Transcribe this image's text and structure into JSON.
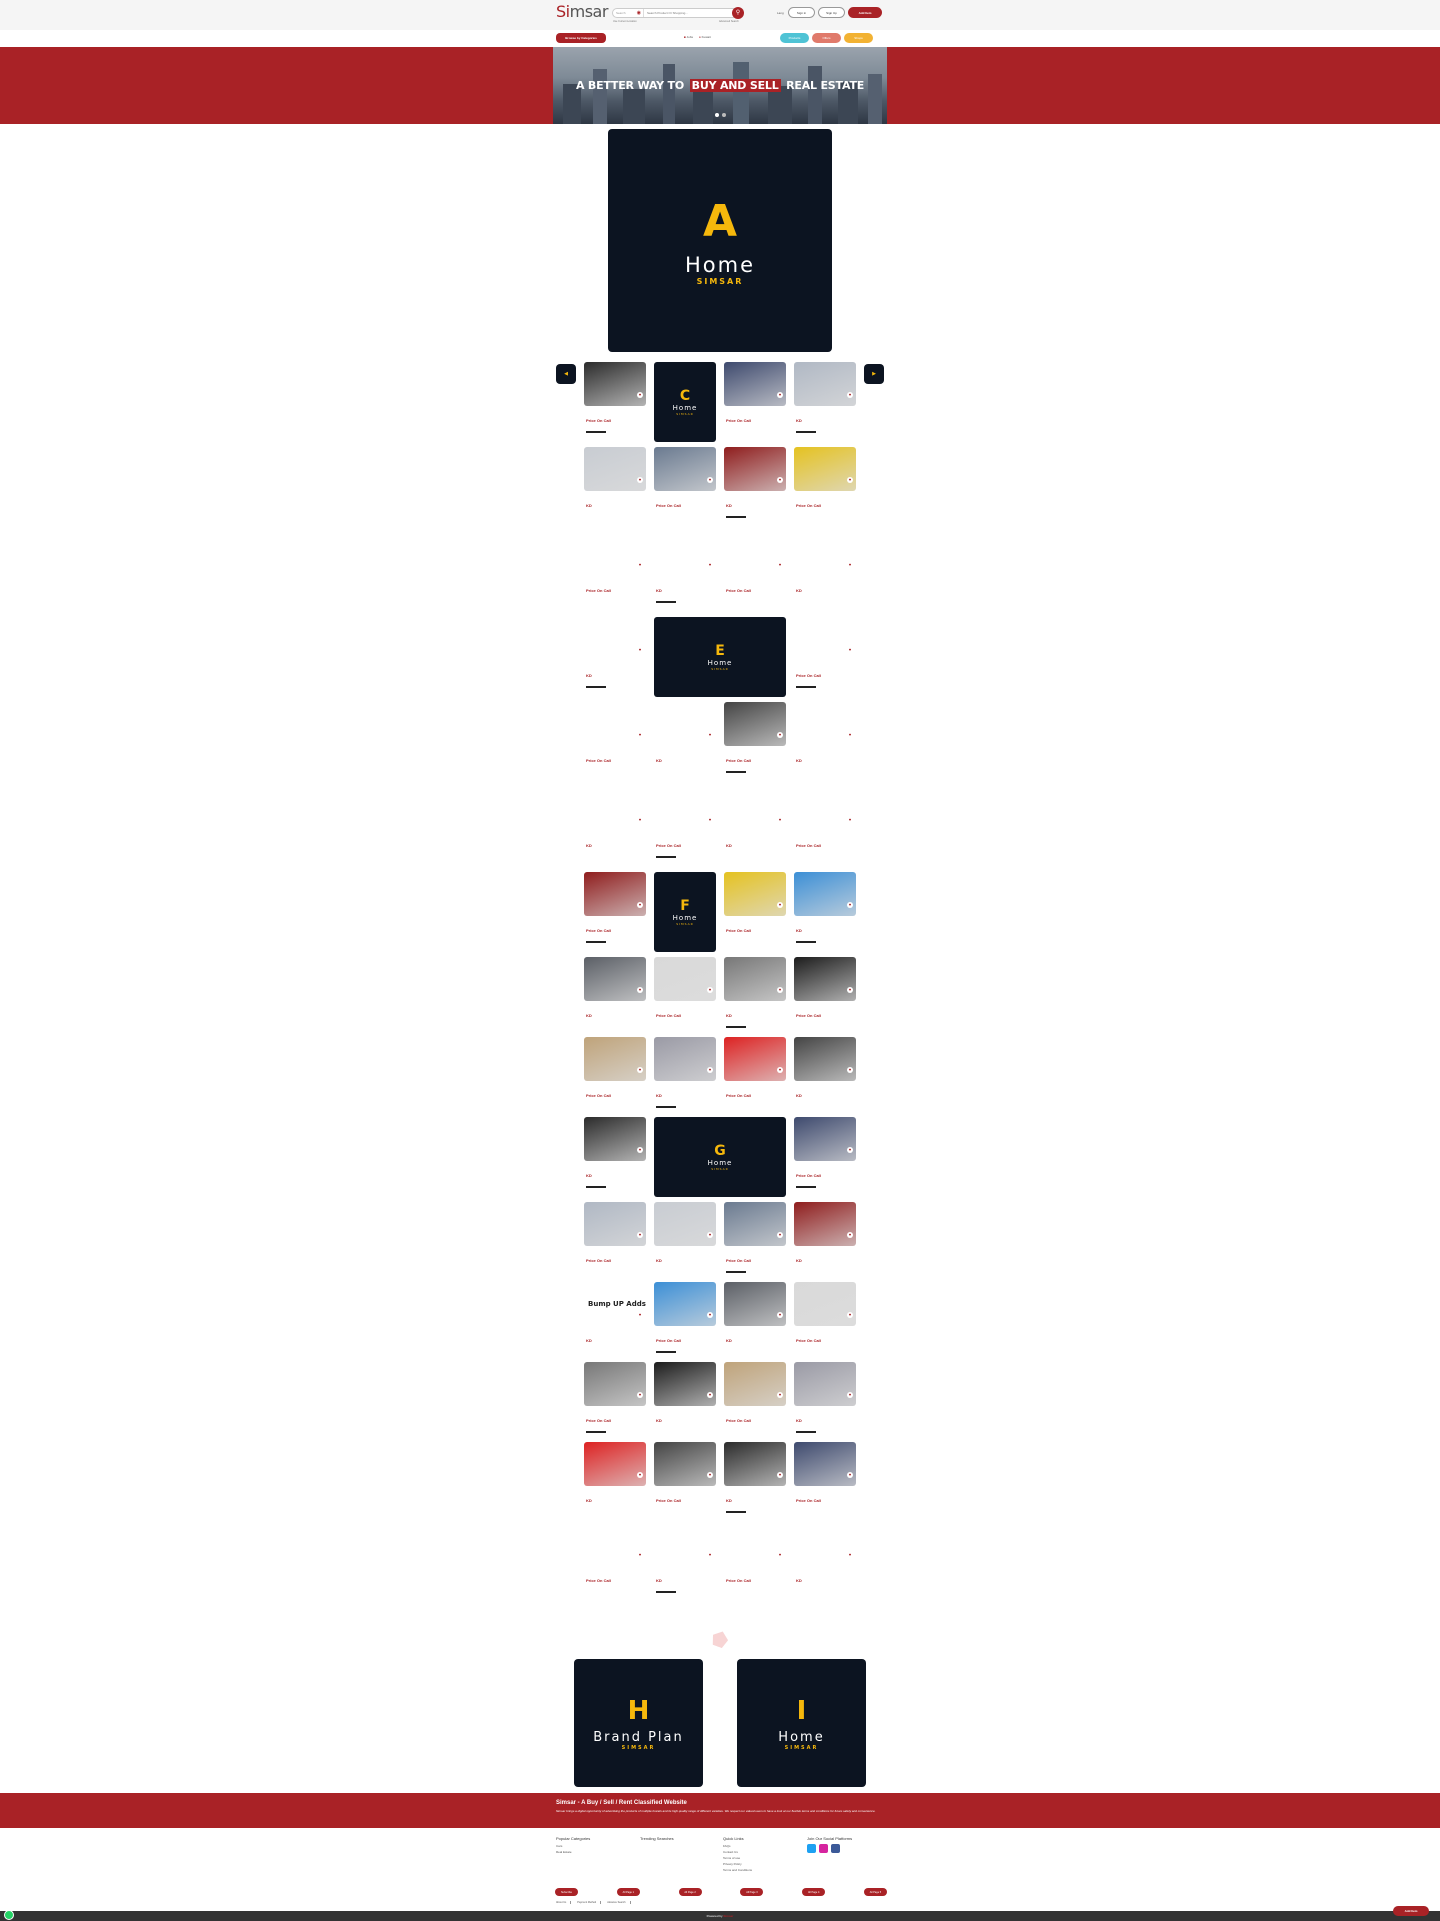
{
  "header": {
    "logo_prefix": "Si",
    "logo_rest": "msar",
    "location_placeholder": "Search",
    "search_placeholder": "Search Product Or Shopping...",
    "sub_left": "Use Current Location",
    "sub_right": "Advanced Search",
    "language": "Lang",
    "signin": "Sign in",
    "signup": "Sign Up",
    "post_ad": "Add Item"
  },
  "nav": {
    "categories": "Browse by Categories",
    "link_jobs": "Jobs",
    "link_kuwait": "Kuwait",
    "pill_1": "Products",
    "pill_2": "Offers",
    "pill_3": "Shops"
  },
  "hero": {
    "text_before": "A BETTER WAY TO",
    "text_highlight": "BUY AND SELL",
    "text_after": "REAL ESTATE"
  },
  "top_banner": {
    "letter": "A",
    "title": "Home",
    "subtitle": "SIMSAR"
  },
  "mini_banners": [
    {
      "letter": "C",
      "title": "Home",
      "subtitle": "SIMSAR"
    },
    {
      "letter": "E",
      "title": "Home",
      "subtitle": "SIMSAR"
    },
    {
      "letter": "F",
      "title": "Home",
      "subtitle": "SIMSAR"
    },
    {
      "letter": "G",
      "title": "Home",
      "subtitle": "SIMSAR"
    }
  ],
  "listing": {
    "price_on_call": "Price On Call",
    "currency": "KD",
    "bump_label": "Bump UP Adds"
  },
  "bottom_banners": [
    {
      "letter": "H",
      "title": "Brand Plan",
      "subtitle": "SIMSAR"
    },
    {
      "letter": "I",
      "title": "Home",
      "subtitle": "SIMSAR"
    }
  ],
  "footer": {
    "title": "Simsar - A Buy / Sell / Rent Classified Website",
    "description": "Simsar brings a digital opportunity of advertising the products of multiple brands and its high quality range of different varieties. We respect our valued users to have a look at our flexible terms and conditions for future safety and convenience.",
    "col1_title": "Popular Categories",
    "col1_items": [
      "Cars",
      "Real Estate"
    ],
    "col2_title": "Trending Searches",
    "col3_title": "Quick Links",
    "col3_items": [
      "FAQs",
      "Contact Us",
      "Terms of use",
      "Privacy Policy",
      "Terms and Conditions"
    ],
    "col4_title": "Join Our Social Platforms",
    "red_buttons": [
      "Subscribe",
      "All Page 1",
      "All Page 2",
      "All Page 3",
      "All Page 4",
      "All Page 5"
    ],
    "legal": [
      "About Us",
      "Payment Method",
      "Advance Search"
    ],
    "powered_prefix": "Powered by",
    "powered_brand": "Simsar",
    "float_post": "Add Item"
  },
  "colors": {
    "brand": "#a92226",
    "banner_bg": "#0c1421",
    "accent_yellow": "#f6b80c"
  }
}
